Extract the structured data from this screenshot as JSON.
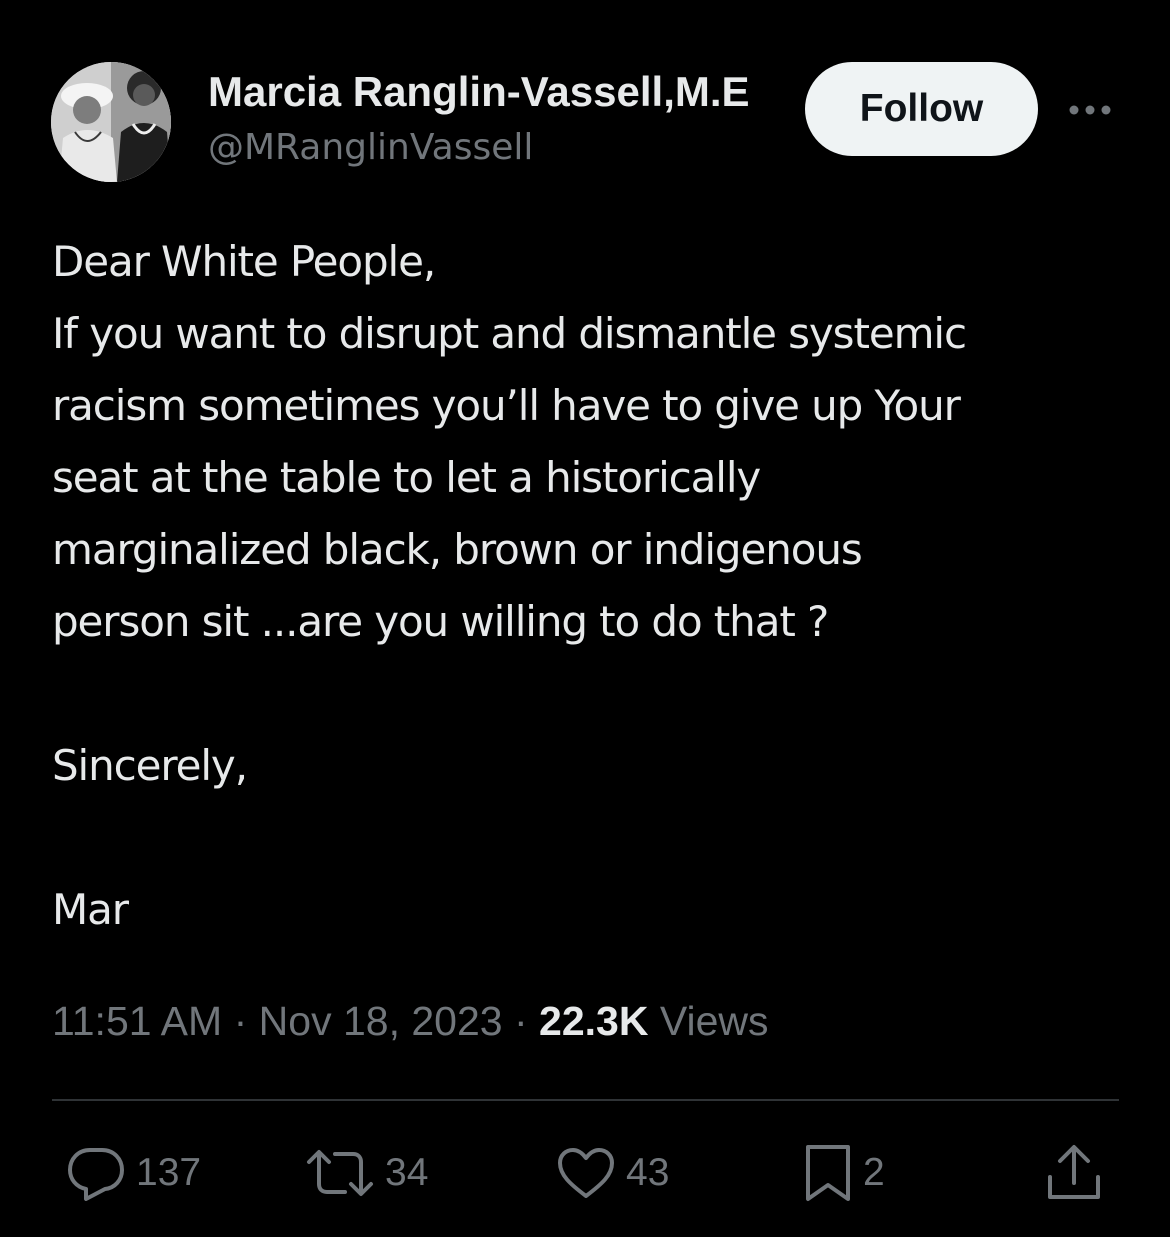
{
  "author": {
    "display_name": "Marcia Ranglin-Vassell,M.E",
    "handle": "@MRanglinVassell",
    "avatar_icon": "profile-photo"
  },
  "follow_label": "Follow",
  "more_icon": "more-dots-icon",
  "tweet": {
    "lines": [
      "Dear White People,",
      "If you want to disrupt and dismantle systemic",
      "racism sometimes you’ll have to give up Your",
      "seat at the table to let a historically",
      "marginalized black, brown or indigenous",
      "person sit ...are you willing to do that ?",
      "",
      "Sincerely,",
      "",
      "Mar"
    ]
  },
  "meta": {
    "time": "11:51 AM",
    "separator": "·",
    "date": "Nov 18, 2023",
    "views_count": "22.3K",
    "views_label": "Views"
  },
  "actions": {
    "replies": {
      "icon": "reply-icon",
      "count": "137"
    },
    "reposts": {
      "icon": "repost-icon",
      "count": "34"
    },
    "likes": {
      "icon": "heart-icon",
      "count": "43"
    },
    "bookmarks": {
      "icon": "bookmark-icon",
      "count": "2"
    },
    "share": {
      "icon": "share-icon"
    }
  },
  "colors": {
    "background": "#000000",
    "primary_text": "#e7e9ea",
    "secondary_text": "#71767b",
    "divider": "#2f3336",
    "follow_bg": "#eff3f4"
  }
}
